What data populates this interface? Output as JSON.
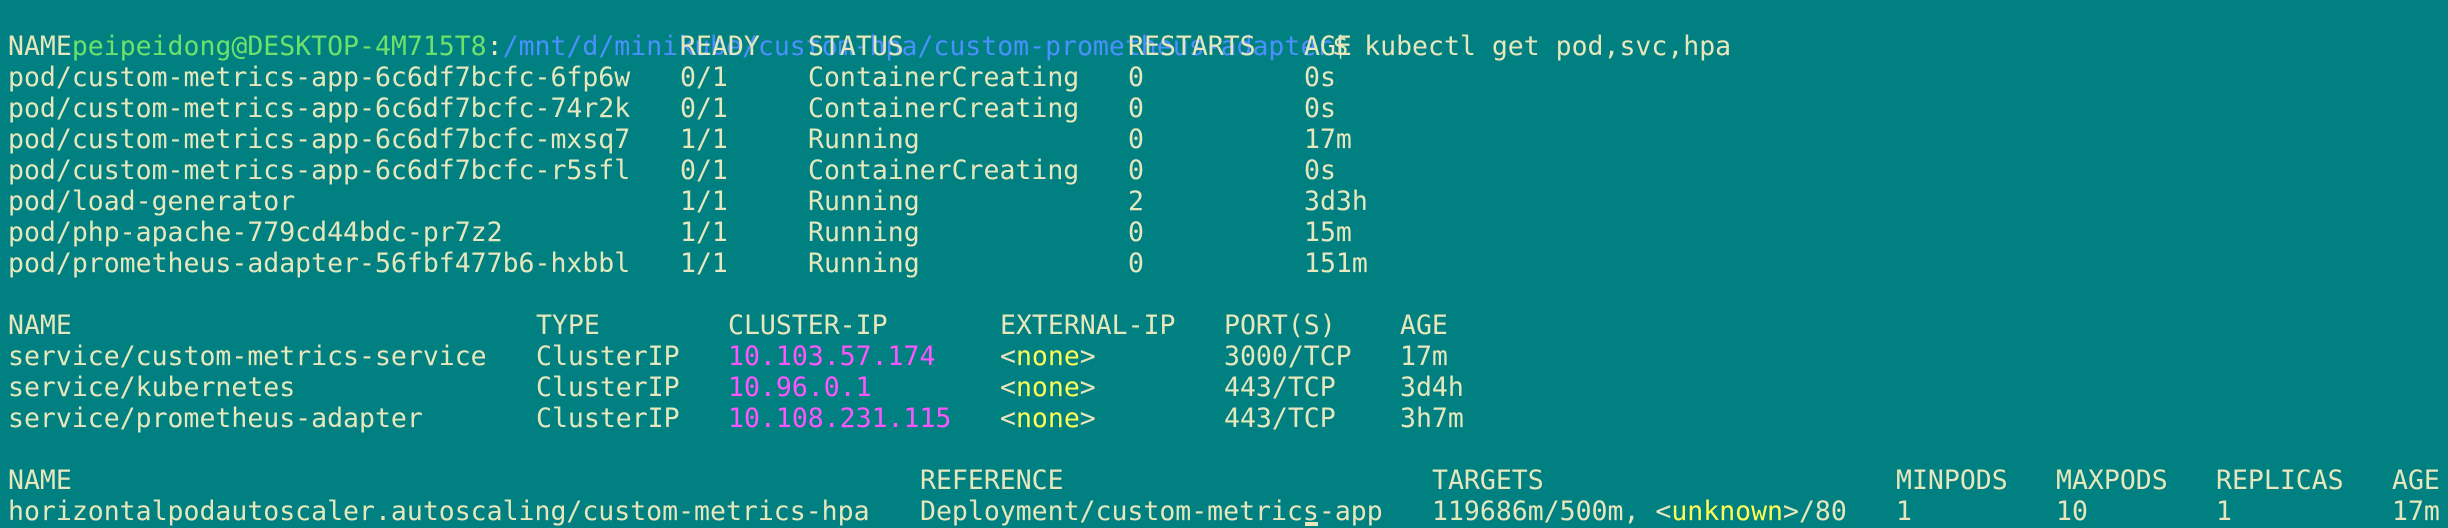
{
  "prompt": {
    "user_host": "peipeidong@DESKTOP-4M715T8",
    "sep": ":",
    "path": "/mnt/d/minikube/custom-hpa/custom-prometheus-adapter",
    "symbol": "$",
    "command": " kubectl get pod,svc,hpa"
  },
  "pods": {
    "headers": [
      "NAME",
      "READY",
      "STATUS",
      "RESTARTS",
      "AGE"
    ],
    "rows": [
      [
        "pod/custom-metrics-app-6c6df7bcfc-6fp6w",
        "0/1",
        "ContainerCreating",
        "0",
        "0s"
      ],
      [
        "pod/custom-metrics-app-6c6df7bcfc-74r2k",
        "0/1",
        "ContainerCreating",
        "0",
        "0s"
      ],
      [
        "pod/custom-metrics-app-6c6df7bcfc-mxsq7",
        "1/1",
        "Running",
        "0",
        "17m"
      ],
      [
        "pod/custom-metrics-app-6c6df7bcfc-r5sfl",
        "0/1",
        "ContainerCreating",
        "0",
        "0s"
      ],
      [
        "pod/load-generator",
        "1/1",
        "Running",
        "2",
        "3d3h"
      ],
      [
        "pod/php-apache-779cd44bdc-pr7z2",
        "1/1",
        "Running",
        "0",
        "15m"
      ],
      [
        "pod/prometheus-adapter-56fbf477b6-hxbbl",
        "1/1",
        "Running",
        "0",
        "151m"
      ]
    ]
  },
  "services": {
    "headers": [
      "NAME",
      "TYPE",
      "CLUSTER-IP",
      "EXTERNAL-IP",
      "PORT(S)",
      "AGE"
    ],
    "rows": [
      [
        "service/custom-metrics-service",
        "ClusterIP",
        "10.103.57.174",
        "none",
        "3000/TCP",
        "17m"
      ],
      [
        "service/kubernetes",
        "ClusterIP",
        "10.96.0.1",
        "none",
        "443/TCP",
        "3d4h"
      ],
      [
        "service/prometheus-adapter",
        "ClusterIP",
        "10.108.231.115",
        "none",
        "443/TCP",
        "3h7m"
      ]
    ]
  },
  "hpa": {
    "headers": [
      "NAME",
      "REFERENCE",
      "TARGETS",
      "MINPODS",
      "MAXPODS",
      "REPLICAS",
      "AGE"
    ],
    "row": {
      "name": "horizontalpodautoscaler.autoscaling/custom-metrics-hpa",
      "reference": "Deployment/custom-metrics-app",
      "targets_a": "119686m/500m, <",
      "targets_b": "unknown",
      "targets_c": ">/80",
      "minpods": "1",
      "maxpods": "10",
      "replicas": "1",
      "age": "17m"
    }
  },
  "colors": {
    "background": "#008080",
    "text": "#e7e7bd",
    "prompt_user": "#6ce26c",
    "prompt_path": "#4a90ff",
    "cluster_ip": "#ff55ff",
    "none_value": "#ffff55"
  }
}
